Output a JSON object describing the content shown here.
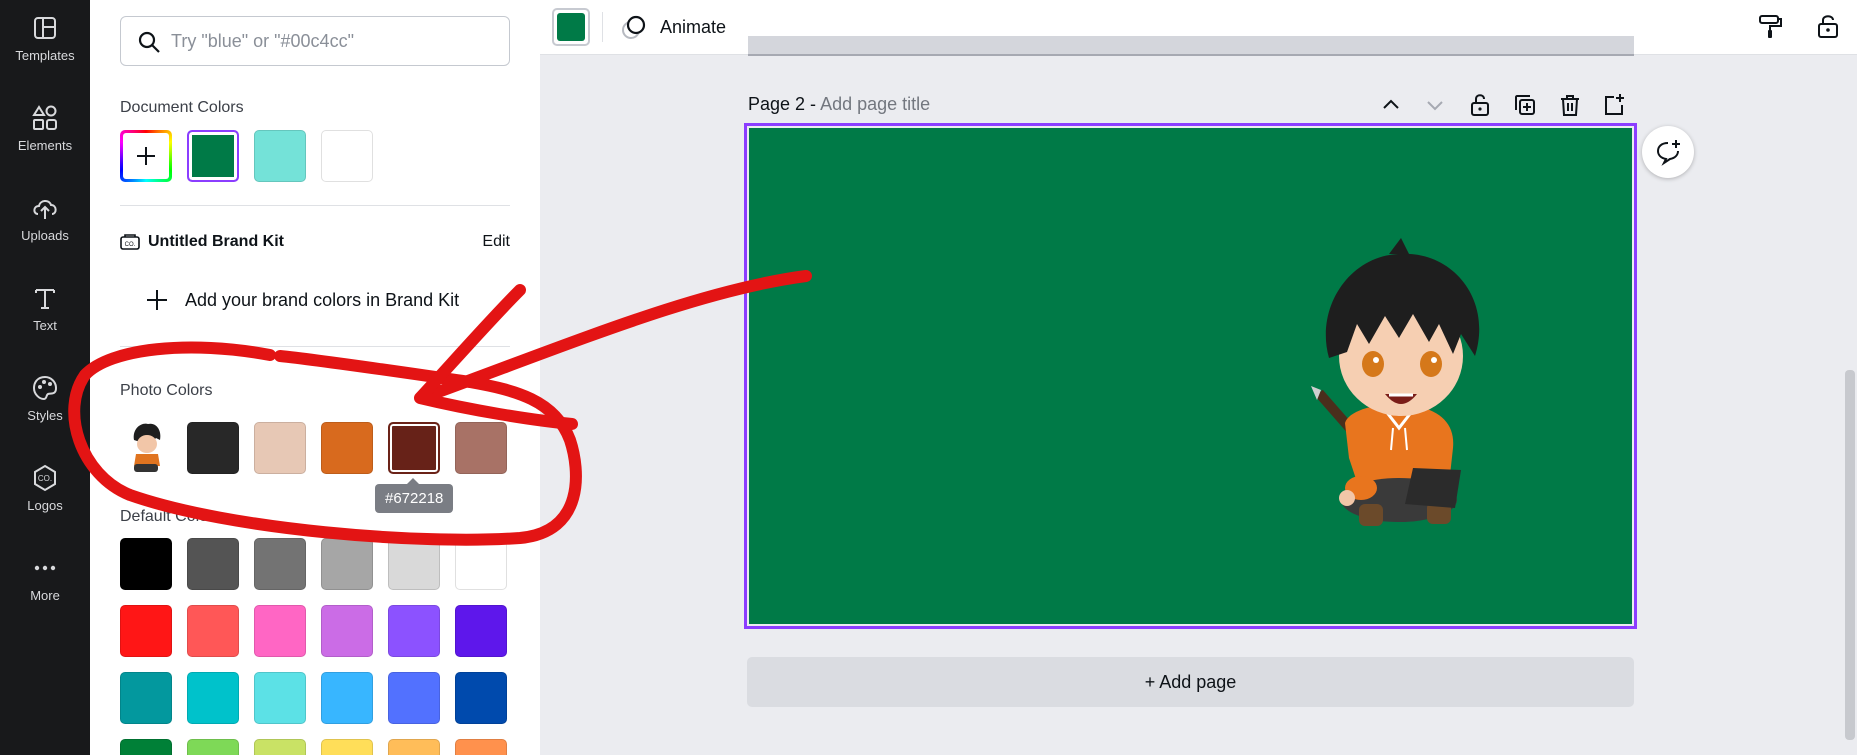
{
  "rail": {
    "items": [
      {
        "label": "Templates",
        "icon": "templates-icon"
      },
      {
        "label": "Elements",
        "icon": "elements-icon"
      },
      {
        "label": "Uploads",
        "icon": "uploads-icon"
      },
      {
        "label": "Text",
        "icon": "text-icon"
      },
      {
        "label": "Styles",
        "icon": "styles-icon"
      },
      {
        "label": "Logos",
        "icon": "logos-icon"
      },
      {
        "label": "More",
        "icon": "more-icon"
      }
    ]
  },
  "panel": {
    "search_placeholder": "Try \"blue\" or \"#00c4cc\"",
    "document_colors_title": "Document Colors",
    "document_colors": [
      "#007a47",
      "#74e2d8",
      "#ffffff"
    ],
    "brand_kit_name": "Untitled Brand Kit",
    "brand_kit_edit": "Edit",
    "add_brand_label": "Add your brand colors in Brand Kit",
    "photo_colors_title": "Photo Colors",
    "photo_colors": [
      "#282828",
      "#e7c8b5",
      "#d86a1e",
      "#672218",
      "#a87266"
    ],
    "tooltip": "#672218",
    "default_colors_title": "Default Colors",
    "default_colors": [
      [
        "#000000",
        "#545454",
        "#737373",
        "#a6a6a6",
        "#d9d9d9",
        "#ffffff"
      ],
      [
        "#ff1616",
        "#ff5757",
        "#ff66c4",
        "#cb6ce6",
        "#8c52ff",
        "#5e17eb"
      ],
      [
        "#03989e",
        "#00c2cb",
        "#5ce1e6",
        "#38b6ff",
        "#5271ff",
        "#004aad"
      ],
      [
        "#008037",
        "#7ed957",
        "#c9e265",
        "#ffde59",
        "#ffbd59",
        "#ff914d"
      ]
    ]
  },
  "topbar": {
    "current_color": "#007a47",
    "animate_label": "Animate"
  },
  "canvas": {
    "page_label": "Page 2 -",
    "page_title_placeholder": "Add page title",
    "page_background": "#007a47",
    "add_page_label": "+ Add page"
  },
  "colors": {
    "accent": "#8b3dff",
    "annotation_red": "#e31414",
    "rail_bg": "#18191b"
  }
}
